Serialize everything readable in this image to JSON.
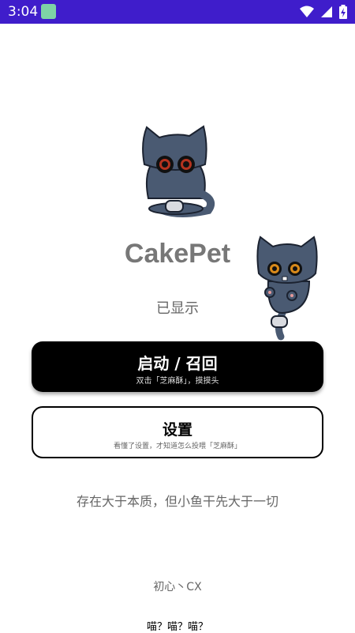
{
  "status_bar": {
    "time": "3:04",
    "icons": [
      "android-app-icon",
      "wifi-icon",
      "signal-icon",
      "battery-icon"
    ]
  },
  "app": {
    "title": "CakePet",
    "display_state": "已显示",
    "primary_button": {
      "label": "启动 / 召回",
      "sublabel": "双击「芝麻酥」，摸摸头"
    },
    "secondary_button": {
      "label": "设置",
      "sublabel": "看懂了设置，才知道怎么投喂「芝麻酥」"
    },
    "motto": "存在大于本质，但小鱼干先大于一切",
    "author": "初心丶CX",
    "meow": "喵？喵？喵？"
  },
  "colors": {
    "status_bar": "#3f1dcb",
    "primary_button_bg": "#000000",
    "title_text": "#777777",
    "cat_fur": "#4a5a72"
  }
}
